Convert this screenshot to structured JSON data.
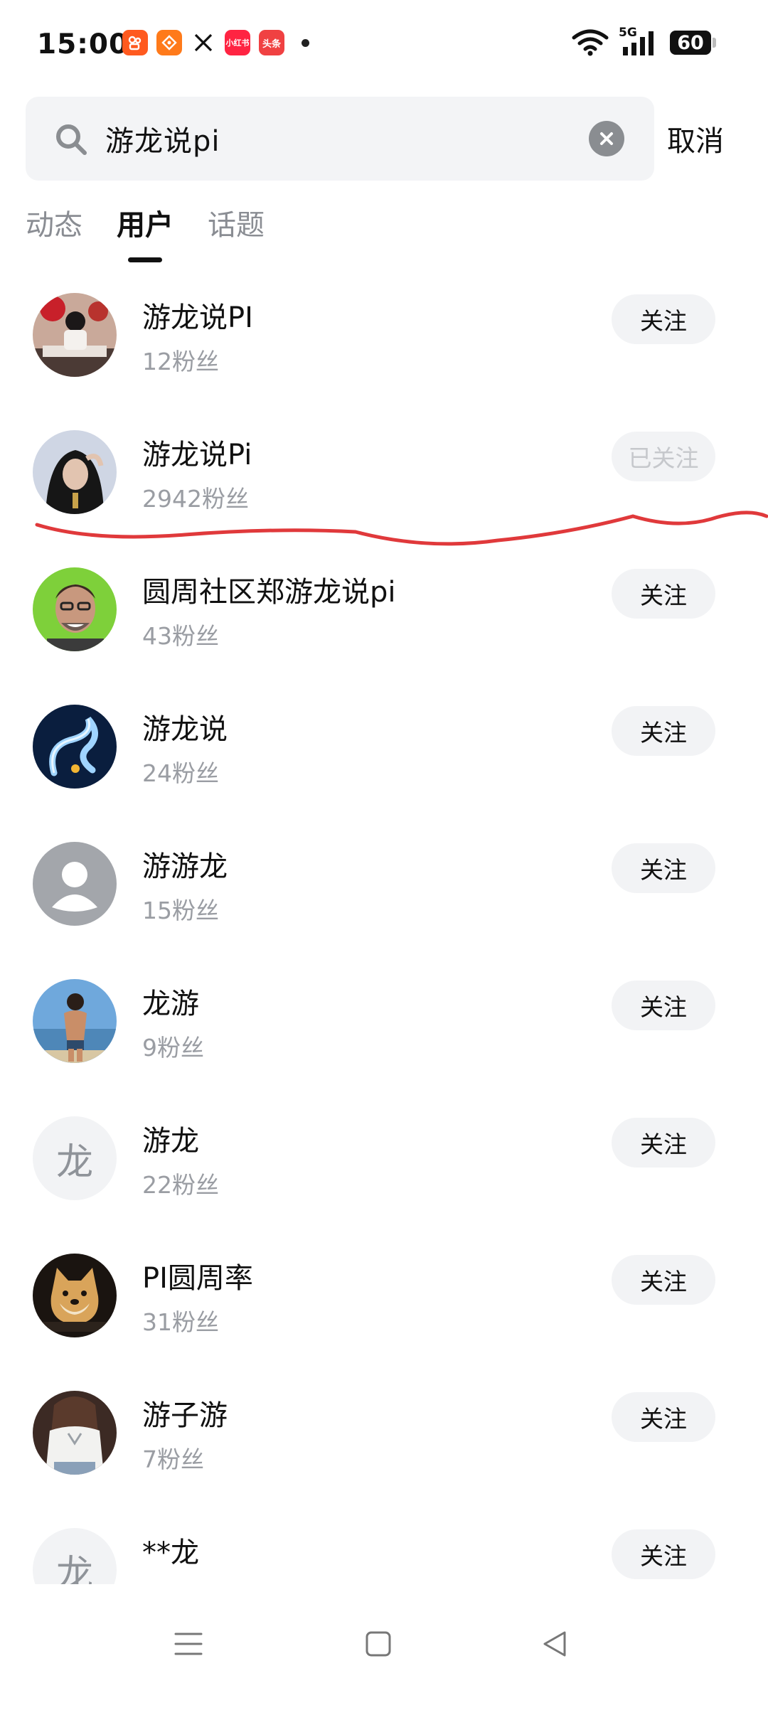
{
  "status": {
    "time": "15:00",
    "network": "5G",
    "battery": "60",
    "apps": [
      {
        "icon": "kuaishou-app-icon",
        "label": "",
        "color": "#ff5a1f"
      },
      {
        "icon": "app-orange-icon",
        "label": "",
        "color": "#ff7a1a"
      },
      {
        "icon": "x-app-icon",
        "label": "𝕏",
        "color": "#ffffff"
      },
      {
        "icon": "xiaohongshu-app-icon",
        "label": "小红书",
        "color": "#ff2442"
      },
      {
        "icon": "toutiao-app-icon",
        "label": "头条",
        "color": "#f04142"
      }
    ]
  },
  "search": {
    "value": "游龙说pi",
    "cancel_label": "取消"
  },
  "tabs": [
    {
      "label": "动态",
      "active": false
    },
    {
      "label": "用户",
      "active": true
    },
    {
      "label": "话题",
      "active": false
    }
  ],
  "users": [
    {
      "name": "游龙说PI",
      "fans": "12粉丝",
      "button": "关注",
      "followed": false,
      "avatar": "photo-person-calligraphy"
    },
    {
      "name": "游龙说Pi",
      "fans": "2942粉丝",
      "button": "已关注",
      "followed": true,
      "avatar": "photo-person-hood"
    },
    {
      "name": "圆周社区郑游龙说pi",
      "fans": "43粉丝",
      "button": "关注",
      "followed": false,
      "avatar": "photo-man-glasses"
    },
    {
      "name": "游龙说",
      "fans": "24粉丝",
      "button": "关注",
      "followed": false,
      "avatar": "photo-dragon"
    },
    {
      "name": "游游龙",
      "fans": "15粉丝",
      "button": "关注",
      "followed": false,
      "avatar": "default-avatar"
    },
    {
      "name": "龙游",
      "fans": "9粉丝",
      "button": "关注",
      "followed": false,
      "avatar": "photo-beach-man"
    },
    {
      "name": "游龙",
      "fans": "22粉丝",
      "button": "关注",
      "followed": false,
      "avatar": "letter",
      "letter": "龙"
    },
    {
      "name": "PI圆周率",
      "fans": "31粉丝",
      "button": "关注",
      "followed": false,
      "avatar": "photo-doge"
    },
    {
      "name": "游子游",
      "fans": "7粉丝",
      "button": "关注",
      "followed": false,
      "avatar": "photo-woman"
    },
    {
      "name": "**龙",
      "fans": "",
      "button": "关注",
      "followed": false,
      "avatar": "letter",
      "letter": "龙"
    }
  ],
  "colors": {
    "annotation": "#e0393b",
    "muted": "#9a9da3",
    "button_bg": "#f2f3f5"
  }
}
